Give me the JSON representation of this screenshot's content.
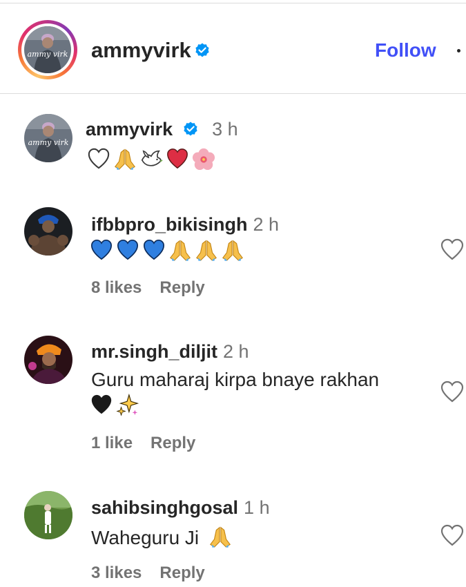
{
  "post_header": {
    "username": "ammyvirk",
    "avatar_caption": "ammy virk",
    "follow_label": "Follow"
  },
  "caption": {
    "username": "ammyvirk",
    "time": "3 h",
    "emojis": [
      "white-heart",
      "folded-hands",
      "dove",
      "red-heart",
      "hibiscus"
    ]
  },
  "comments": [
    {
      "username": "ifbbpro_bikisingh",
      "time": "2 h",
      "text": "",
      "emojis": [
        "blue-heart",
        "blue-heart",
        "blue-heart",
        "folded-hands",
        "folded-hands",
        "folded-hands"
      ],
      "likes": "8 likes",
      "reply_label": "Reply"
    },
    {
      "username": "mr.singh_diljit",
      "time": "2 h",
      "text": "Guru maharaj kirpa bnaye rakhan",
      "emojis": [
        "black-heart",
        "sparkles"
      ],
      "likes": "1 like",
      "reply_label": "Reply"
    },
    {
      "username": "sahibsinghgosal",
      "time": "1 h",
      "text": "Waheguru Ji",
      "emojis": [
        "folded-hands"
      ],
      "likes": "3 likes",
      "reply_label": "Reply"
    }
  ],
  "colors": {
    "accent_blue": "#4150f7",
    "verified_blue": "#0095f6",
    "muted_text": "#737373",
    "text": "#262626",
    "divider": "#dbdbdb"
  }
}
